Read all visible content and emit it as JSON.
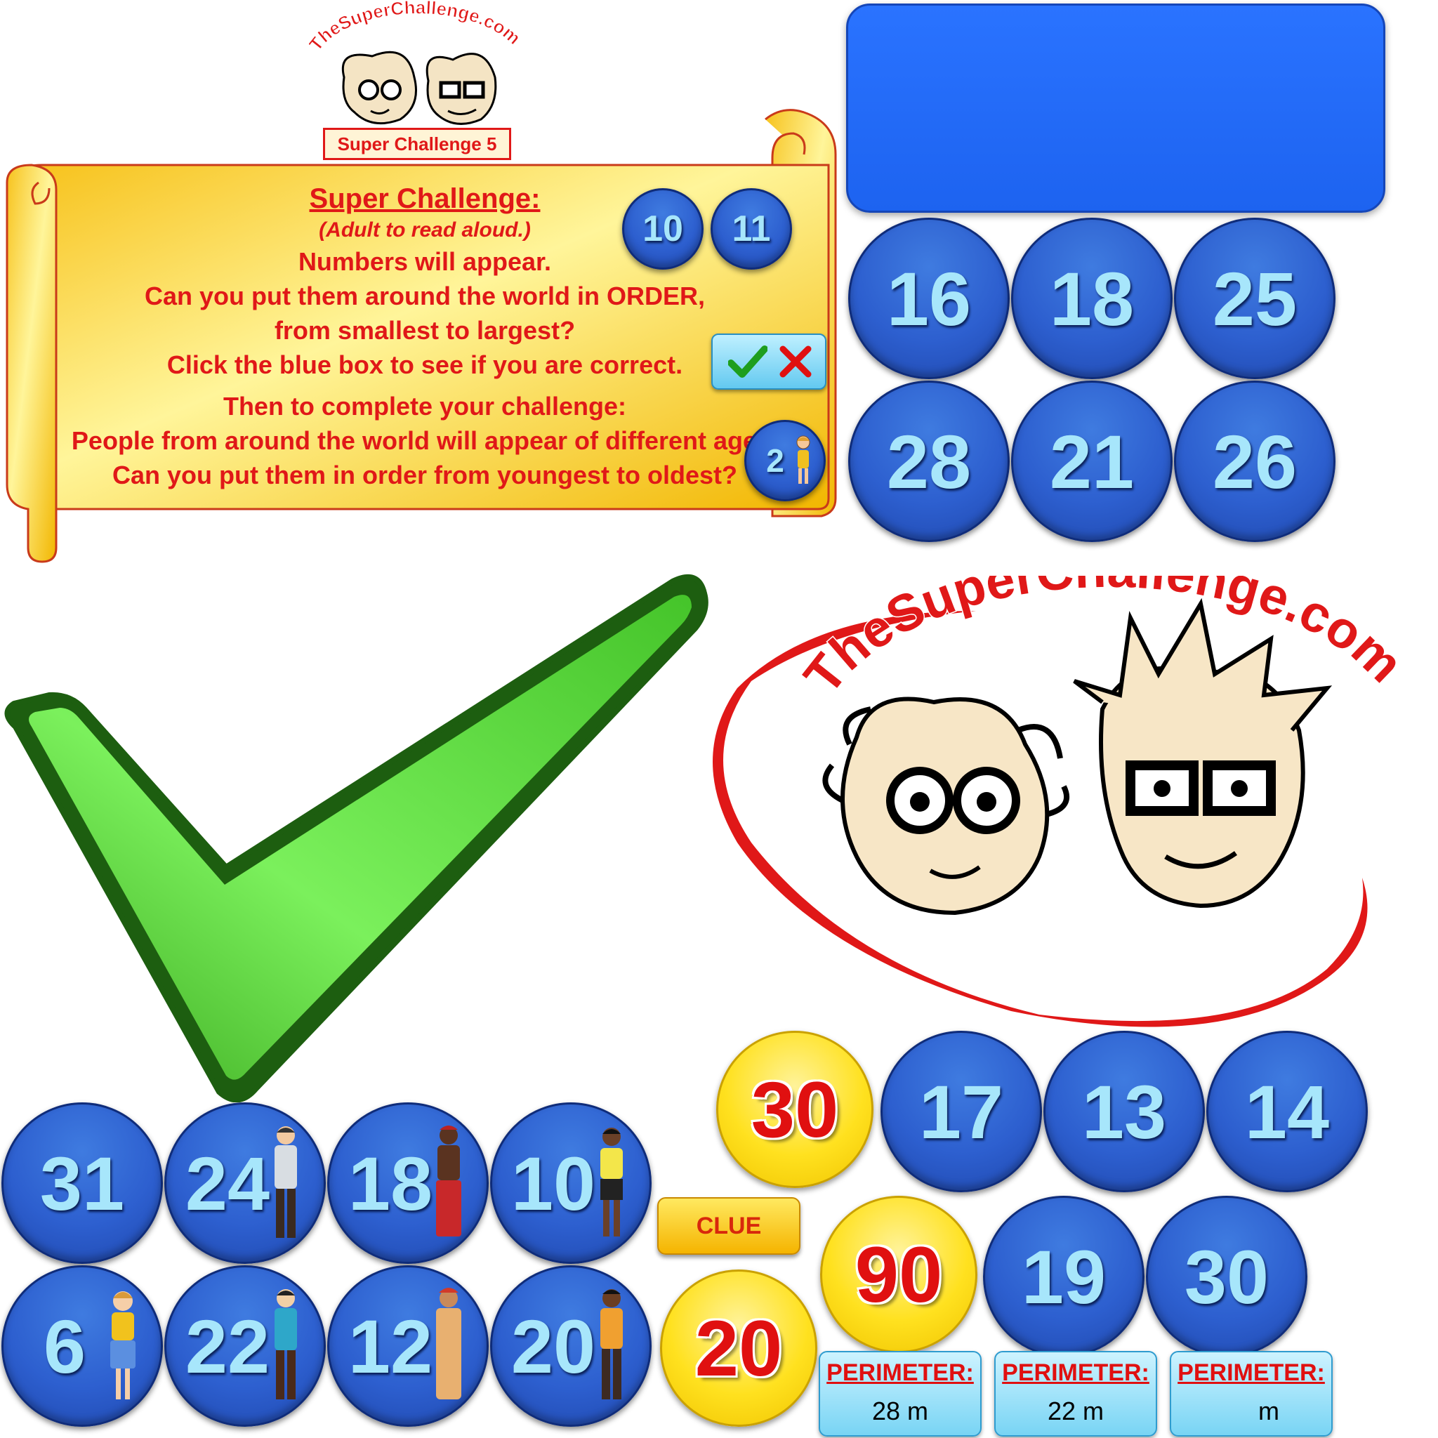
{
  "small_logo": {
    "site_name": "TheSuperChallenge.com",
    "banner_label": "Super Challenge 5"
  },
  "big_logo": {
    "site_name": "TheSuperChallenge.com"
  },
  "scroll": {
    "title": "Super Challenge:",
    "subtitle": "(Adult to read aloud.)",
    "lines": [
      "Numbers will appear.",
      "Can you put them around the world in ORDER,",
      "from smallest to largest?",
      "Click the blue box to see if you are correct.",
      "Then to complete your challenge:",
      "People from around the world will appear of different ages.",
      "Can you put them in order from youngest to oldest?"
    ],
    "example_numbers": [
      "10",
      "11"
    ],
    "example_person_number": "2"
  },
  "number_grid_top": [
    "16",
    "18",
    "25",
    "28",
    "21",
    "26"
  ],
  "right_numbers_row1": [
    "17",
    "13",
    "14"
  ],
  "right_numbers_row2": [
    "19",
    "30"
  ],
  "yellow_numbers": [
    "30",
    "90",
    "20"
  ],
  "people_discs_row1": [
    "31",
    "24",
    "18",
    "10"
  ],
  "people_discs_row2": [
    "6",
    "22",
    "12",
    "20"
  ],
  "clue_button": {
    "label": "CLUE"
  },
  "perimeter_cards": [
    {
      "label": "PERIMETER:",
      "value": "28",
      "unit": "m"
    },
    {
      "label": "PERIMETER:",
      "value": "22",
      "unit": "m"
    },
    {
      "label": "PERIMETER:",
      "value": "",
      "unit": "m"
    }
  ],
  "colors": {
    "disc_blue": "#2d5fcf",
    "disc_text": "#a7e6fb",
    "answer_box": "#1f68f5",
    "scroll_gold": "#ffd22e",
    "scroll_text_red": "#e01818",
    "check_green": "#46c42c",
    "logo_red": "#e01818"
  },
  "icons": [
    "checkmark-icon",
    "cross-icon",
    "person-icon"
  ]
}
